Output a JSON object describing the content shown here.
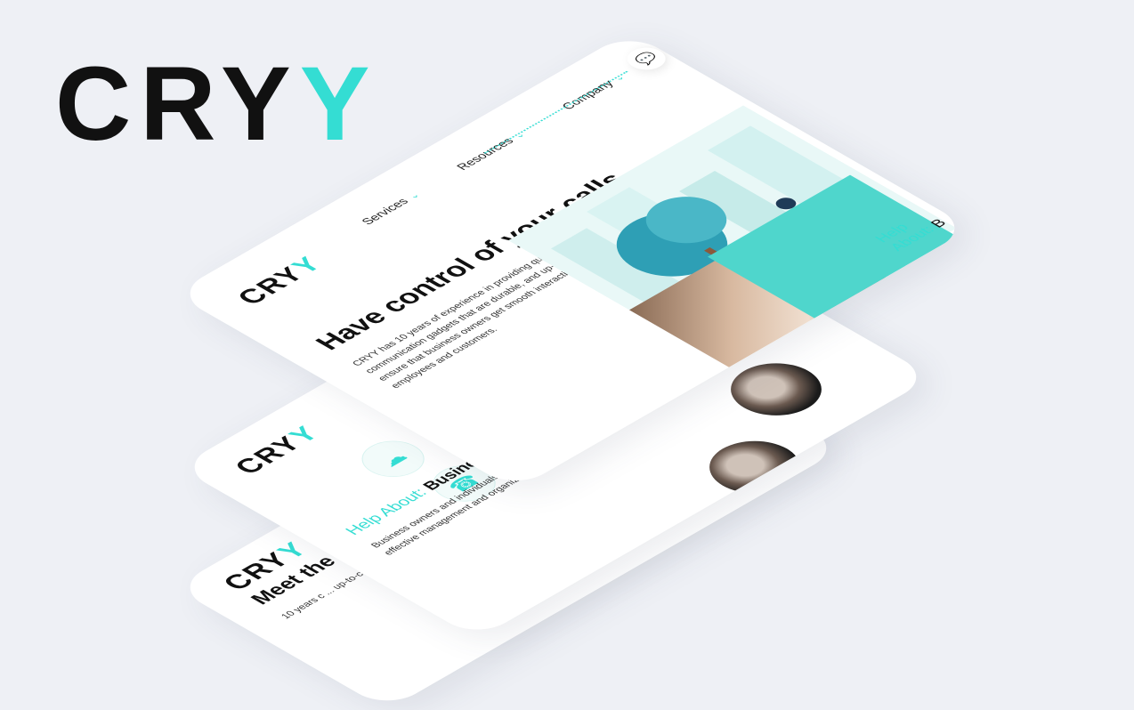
{
  "brand": {
    "main": "CRY",
    "accent": "Y",
    "accent_color": "#34ddd3"
  },
  "card1": {
    "logo_main": "CRY",
    "logo_accent": "Y",
    "nav": [
      {
        "label": "Services"
      },
      {
        "label": "Resources"
      },
      {
        "label": "Company"
      }
    ],
    "hero_title": "Have control of your calls",
    "hero_desc": "CRYY has 10 years of experience in providing quality communication gadgets that are durable, and up-to-date to ensure that business owners get smooth interaction between employees and customers.",
    "help_label": "Help About:",
    "help_value": "B"
  },
  "card2": {
    "logo_main": "CRY",
    "logo_accent": "Y",
    "help_label": "Help About:",
    "help_value": "Business",
    "desc": "Business owners and individuals overcome the problem of poor ... effective management and organization."
  },
  "card3": {
    "logo_main": "CRY",
    "logo_accent": "Y",
    "title": "Meet the T",
    "desc": "10 years c ... up-to-c ... cust"
  },
  "icons": {
    "chat": "chat-bubble-icon",
    "cloud": "cloud-icon",
    "phone": "phone-icon",
    "chevron": "chevron-down-icon"
  }
}
